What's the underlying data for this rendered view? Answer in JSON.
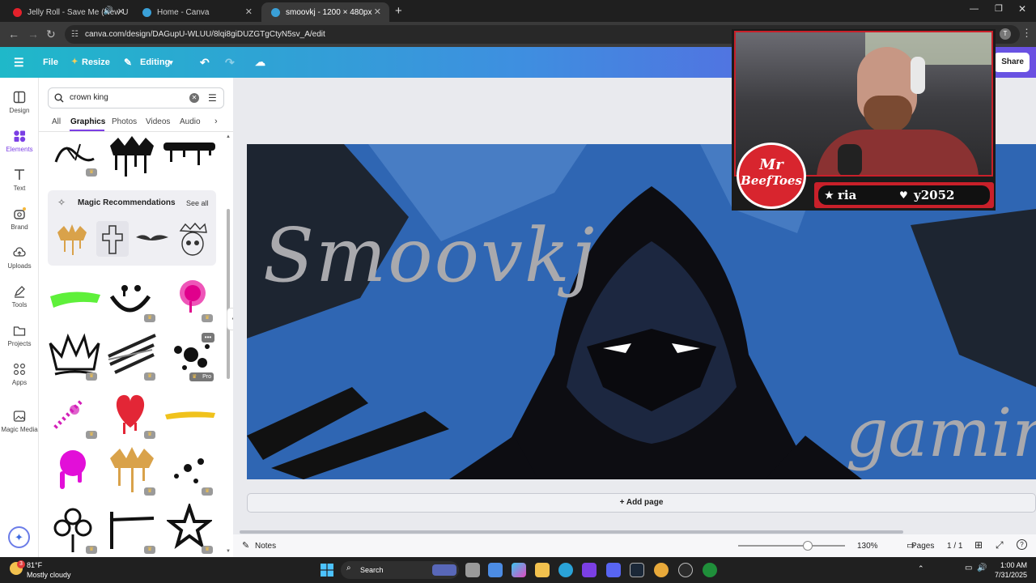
{
  "browser": {
    "tabs": [
      {
        "title": "Jelly Roll - Save Me (New U",
        "favicon_color": "#e4212b",
        "active": false
      },
      {
        "title": "Home - Canva",
        "favicon_color": "#3aa0d8",
        "active": false
      },
      {
        "title": "smoovkj - 1200 × 480px",
        "favicon_color": "#3aa0d8",
        "active": true
      }
    ],
    "new_tab": "+",
    "url": "canva.com/design/DAGupU-WLUU/8lqi8giDUZGTgCtyN5sv_A/edit",
    "profile_initial": "T"
  },
  "canva_header": {
    "file": "File",
    "resize": "Resize",
    "editing": "Editing",
    "share": "Share"
  },
  "rail": [
    {
      "label": "Design",
      "icon": "layout-icon"
    },
    {
      "label": "Elements",
      "icon": "shapes-icon"
    },
    {
      "label": "Text",
      "icon": "text-icon"
    },
    {
      "label": "Brand",
      "icon": "brand-icon"
    },
    {
      "label": "Uploads",
      "icon": "cloud-upload-icon"
    },
    {
      "label": "Tools",
      "icon": "pen-icon"
    },
    {
      "label": "Projects",
      "icon": "folder-icon"
    },
    {
      "label": "Apps",
      "icon": "apps-icon"
    },
    {
      "label": "Magic Media",
      "icon": "image-magic-icon"
    }
  ],
  "panel": {
    "search_value": "crown king",
    "tabs": [
      "All",
      "Graphics",
      "Photos",
      "Videos",
      "Audio"
    ],
    "active_tab": "Graphics",
    "magic_title": "Magic Recommendations",
    "see_all": "See all",
    "pro_label": "Pro"
  },
  "design": {
    "title_text": "Smoovkj",
    "subtitle_text": "gamin",
    "bg_color": "#2f66b3"
  },
  "add_page": "+ Add page",
  "footer": {
    "notes": "Notes",
    "zoom": "130%",
    "pages": "Pages",
    "page_count": "1 / 1"
  },
  "overlay": {
    "logo_line1": "Mr",
    "logo_line2": "BeefToes",
    "left_badge": "ria",
    "right_badge": "y2052"
  },
  "taskbar": {
    "weather_temp": "81°F",
    "weather_desc": "Mostly cloudy",
    "search": "Search",
    "time": "1:00 AM",
    "date": "7/31/2025",
    "notification_count": "3"
  }
}
